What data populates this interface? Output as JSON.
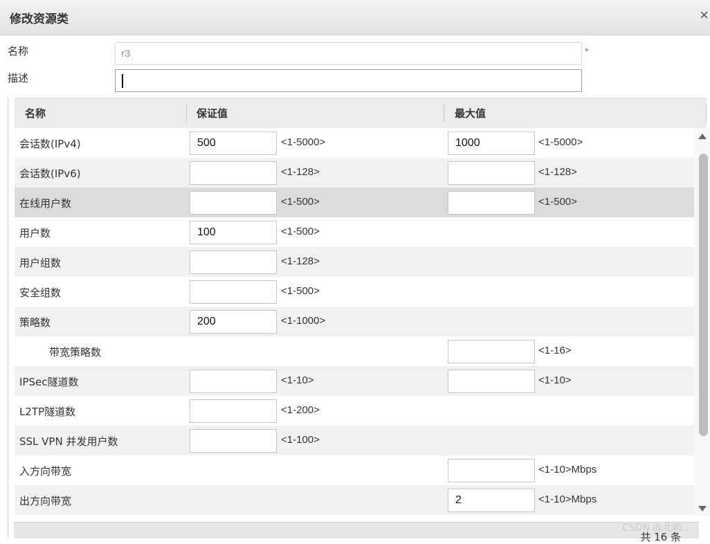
{
  "dialog": {
    "title": "修改资源类",
    "close": "×"
  },
  "form": {
    "name_label": "名称",
    "name_value": "r3",
    "required_mark": "*",
    "desc_label": "描述",
    "desc_value": ""
  },
  "table": {
    "headers": {
      "name": "名称",
      "guarantee": "保证值",
      "max": "最大值"
    },
    "rows": [
      {
        "name": "会话数(IPv4)",
        "g_value": "500",
        "g_range": "<1-5000>",
        "m_value": "1000",
        "m_range": "<1-5000>"
      },
      {
        "name": "会话数(IPv6)",
        "g_value": "",
        "g_range": "<1-128>",
        "m_value": "",
        "m_range": "<1-128>"
      },
      {
        "name": "在线用户数",
        "g_value": "",
        "g_range": "<1-500>",
        "m_value": "",
        "m_range": "<1-500>"
      },
      {
        "name": "用户数",
        "g_value": "100",
        "g_range": "<1-500>"
      },
      {
        "name": "用户组数",
        "g_value": "",
        "g_range": "<1-128>"
      },
      {
        "name": "安全组数",
        "g_value": "",
        "g_range": "<1-500>"
      },
      {
        "name": "策略数",
        "g_value": "200",
        "g_range": "<1-1000>"
      },
      {
        "name": "带宽策略数",
        "m_value": "",
        "m_range": "<1-16>"
      },
      {
        "name": "IPSec隧道数",
        "g_value": "",
        "g_range": "<1-10>",
        "m_value": "",
        "m_range": "<1-10>"
      },
      {
        "name": "L2TP隧道数",
        "g_value": "",
        "g_range": "<1-200>"
      },
      {
        "name": "SSL VPN 并发用户数",
        "g_value": "",
        "g_range": "<1-100>"
      },
      {
        "name": "入方向带宽",
        "m_value": "",
        "m_range": "<1-10>Mbps"
      },
      {
        "name": "出方向带宽",
        "m_value": "2",
        "m_range": "<1-10>Mbps"
      }
    ]
  },
  "footer": {
    "count": "共 16 条"
  },
  "watermark": "CSDN @北屿.."
}
